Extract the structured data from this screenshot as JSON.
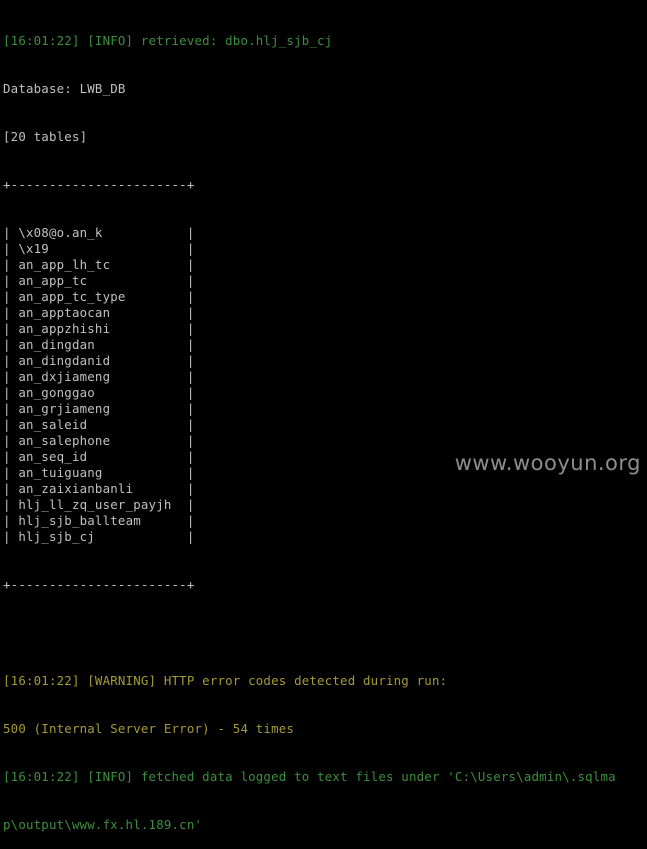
{
  "terminal": {
    "header_lines": [
      "[16:01:22] [INFO] retrieved: dbo.hlj_sjb_cj",
      "Database: LWB_DB",
      "[20 tables]"
    ],
    "table_border": "+-----------------------+",
    "table_rows": [
      "\\x08@o.an_k",
      "\\x19",
      "an_app_lh_tc",
      "an_app_tc",
      "an_app_tc_type",
      "an_apptaocan",
      "an_appzhishi",
      "an_dingdan",
      "an_dingdanid",
      "an_dxjiameng",
      "an_gonggao",
      "an_grjiameng",
      "an_saleid",
      "an_salephone",
      "an_seq_id",
      "an_tuiguang",
      "an_zaixianbanli",
      "hlj_ll_zq_user_payjh",
      "hlj_sjb_ballteam",
      "hlj_sjb_cj"
    ],
    "footer_lines": [
      "[16:01:22] [WARNING] HTTP error codes detected during run:",
      "500 (Internal Server Error) - 54 times",
      "[16:01:22] [INFO] fetched data logged to text files under 'C:\\Users\\admin\\.sqlma",
      "p\\output\\www.fx.hl.189.cn'"
    ]
  },
  "watermark": "www.wooyun.org",
  "colors": {
    "background": "#000000",
    "text": "#c0c0c0",
    "info_green": "#3c8f3c",
    "warning_yellow": "#a59a34"
  }
}
